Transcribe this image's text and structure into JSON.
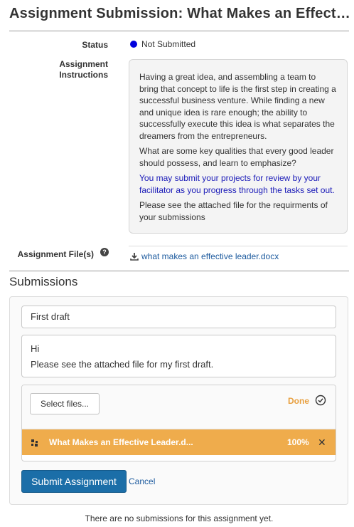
{
  "page": {
    "title": "Assignment Submission: What Makes an Effective Leader"
  },
  "details": {
    "status_label": "Status",
    "status_value": "Not Submitted",
    "status_color": "#0000dd",
    "instructions_label_line1": "Assignment",
    "instructions_label_line2": "Instructions",
    "instructions": {
      "paragraph_1": "Having a great idea, and assembling a team to bring that concept to life is the first step in creating a successful business venture. While finding a new and unique idea is rare enough; the ability to successfully execute this idea is what separates the dreamers from the entrepreneurs.",
      "paragraph_2": "What are some key qualities that every good leader should possess, and learn to emphasize?",
      "paragraph_3": "You may submit your projects for review by your facilitator as you progress through the tasks set out.",
      "paragraph_4": "Please see the attached file for the requirments of your submissions"
    },
    "files_label": "Assignment File(s)",
    "help_icon": "question-circle-icon",
    "file_link": "what makes an effective leader.docx",
    "file_icon": "download-icon"
  },
  "submissions": {
    "heading": "Submissions",
    "form": {
      "title_value": "First draft",
      "body_line1": "Hi",
      "body_line2": "Please see the attached file for my first draft.",
      "select_files_label": "Select files...",
      "upload_status": "Done",
      "upload_status_icon": "check-circle-icon",
      "uploaded_file": {
        "name": "What Makes an Effective Leader.d...",
        "progress": "100%",
        "progress_fraction": 1.0,
        "icon": "file-icon",
        "remove_icon": "close-icon"
      },
      "submit_label": "Submit Assignment",
      "cancel_label": "Cancel"
    },
    "empty_message": "There are no submissions for this assignment yet."
  },
  "colors": {
    "accent": "#1b6ea8",
    "link": "#1c5a9e",
    "upload_bar": "#efac4c",
    "done_text": "#e8a040"
  }
}
